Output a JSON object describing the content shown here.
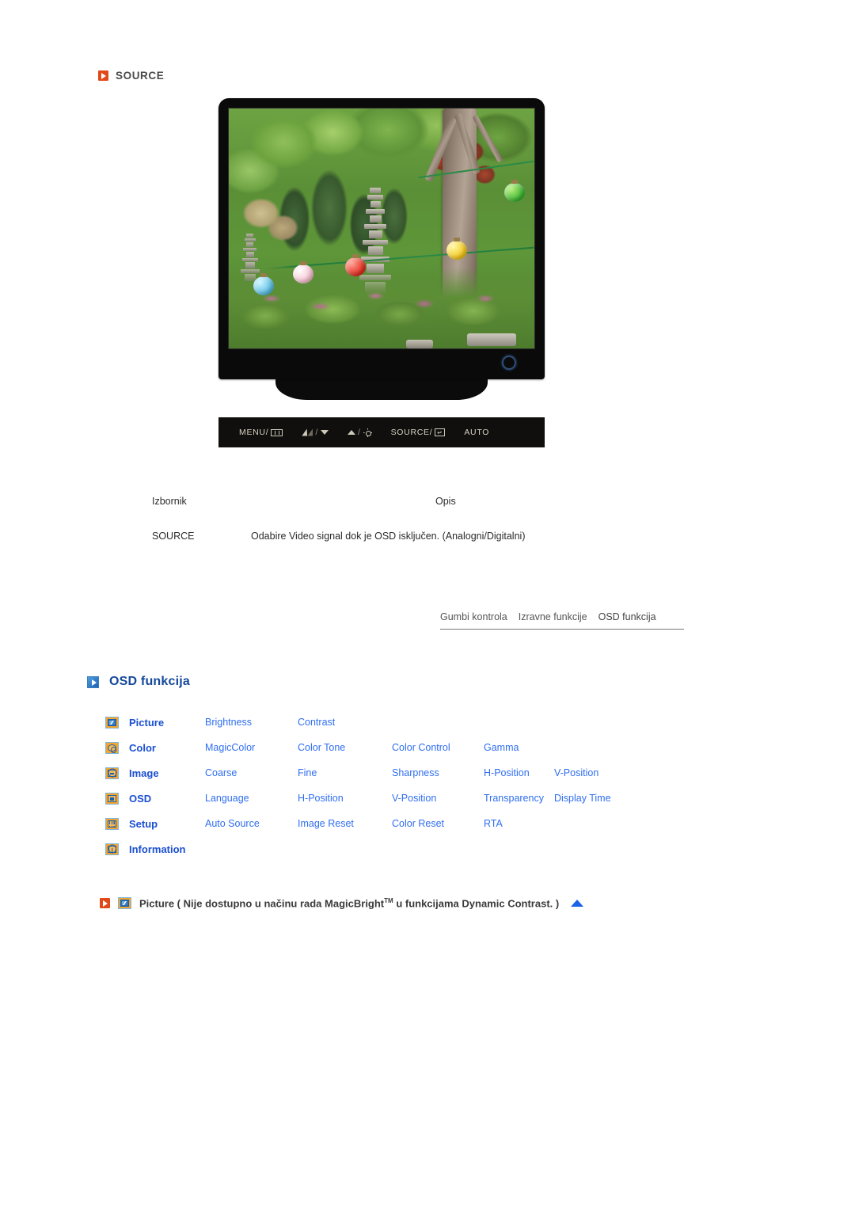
{
  "section": {
    "source_heading": "SOURCE",
    "source_icon": "play-triangle-red-icon"
  },
  "monitor": {
    "screen_image_alt": "korean-garden-pagoda-lanterns",
    "power_led": "power-indicator-ring",
    "buttons": [
      {
        "label": "MENU/",
        "glyph": "menu-icon"
      },
      {
        "label": "/",
        "glyph_left": "contrast-icon",
        "glyph_right": "arrow-down-icon"
      },
      {
        "label": "/",
        "glyph_left": "arrow-up-icon",
        "glyph_right": "brightness-sun-icon"
      },
      {
        "label": "SOURCE/",
        "glyph": "enter-icon"
      },
      {
        "label": "AUTO",
        "glyph": ""
      }
    ],
    "button_labels": {
      "menu": "MENU/",
      "source": "SOURCE/",
      "auto": "AUTO",
      "slash": "/",
      "enter_glyph": "↵"
    }
  },
  "desc_table": {
    "headers": {
      "menu": "Izbornik",
      "description": "Opis"
    },
    "rows": [
      {
        "menu": "SOURCE",
        "description": "Odabire Video signal dok je OSD isključen. (Analogni/Digitalni)"
      }
    ]
  },
  "tabs": [
    {
      "label": "Gumbi kontrola",
      "active": false
    },
    {
      "label": "Izravne funkcije",
      "active": false
    },
    {
      "label": "OSD funkcija",
      "active": true
    }
  ],
  "osd_section": {
    "heading": "OSD funkcija",
    "heading_icon": "play-triangle-blue-icon"
  },
  "osd_functions": {
    "rows": [
      {
        "icon": "picture-icon",
        "category": "Picture",
        "items": [
          "Brightness",
          "Contrast",
          "",
          "",
          ""
        ]
      },
      {
        "icon": "color-icon",
        "category": "Color",
        "items": [
          "MagicColor",
          "Color Tone",
          "Color Control",
          "Gamma",
          ""
        ]
      },
      {
        "icon": "image-icon",
        "category": "Image",
        "items": [
          "Coarse",
          "Fine",
          "Sharpness",
          "H-Position",
          "V-Position"
        ]
      },
      {
        "icon": "osd-icon",
        "category": "OSD",
        "items": [
          "Language",
          "H-Position",
          "V-Position",
          "Transparency",
          "Display Time"
        ]
      },
      {
        "icon": "setup-icon",
        "category": "Setup",
        "items": [
          "Auto Source",
          "Image Reset",
          "Color Reset",
          "RTA",
          ""
        ]
      },
      {
        "icon": "information-icon",
        "category": "Information",
        "items": [
          "",
          "",
          "",
          "",
          ""
        ]
      }
    ]
  },
  "footer_note": {
    "bullet_icon": "play-triangle-red-icon",
    "category_icon": "picture-icon",
    "text_before": "Picture ( Nije dostupno u načinu rada MagicBright",
    "trademark": "TM",
    "text_after": " u funkcijama Dynamic Contrast. )",
    "scroll_top_icon": "triangle-up-blue-icon"
  },
  "colors": {
    "link_blue": "#2f6ef0",
    "category_blue": "#1a4fd0",
    "heading_blue": "#14489a",
    "accent_orange": "#e04a18",
    "icon_orange": "#f2a531",
    "triangle_blue": "#1a62e8"
  }
}
